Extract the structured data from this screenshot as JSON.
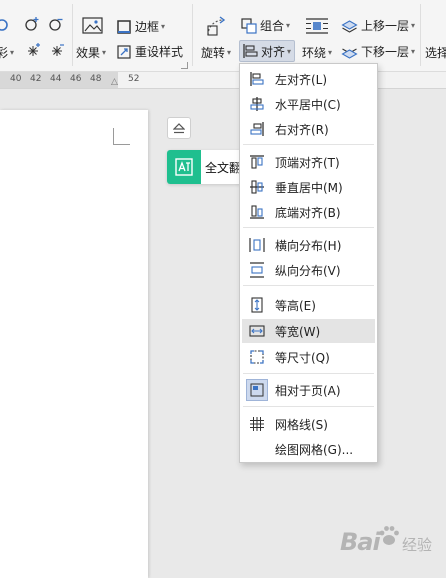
{
  "ribbon": {
    "color_fill_label": "彩",
    "effects_label": "效果",
    "border_label": "边框",
    "reset_style_label": "重设样式",
    "rotate_label": "旋转",
    "group_label": "组合",
    "align_label": "对齐",
    "wrap_label": "环绕",
    "bring_forward_label": "上移一层",
    "send_backward_label": "下移一层",
    "select_label": "选择"
  },
  "ruler": {
    "ticks": [
      "40",
      "42",
      "44",
      "46",
      "48",
      "52"
    ]
  },
  "sidebar": {
    "translate_label": "全文翻"
  },
  "align_menu": {
    "items": [
      {
        "label": "左对齐(L)",
        "icon": "align-left-icon"
      },
      {
        "label": "水平居中(C)",
        "icon": "align-center-icon"
      },
      {
        "label": "右对齐(R)",
        "icon": "align-right-icon"
      },
      {
        "label": "顶端对齐(T)",
        "icon": "align-top-icon"
      },
      {
        "label": "垂直居中(M)",
        "icon": "align-middle-icon"
      },
      {
        "label": "底端对齐(B)",
        "icon": "align-bottom-icon"
      },
      {
        "label": "横向分布(H)",
        "icon": "distribute-horizontal-icon"
      },
      {
        "label": "纵向分布(V)",
        "icon": "distribute-vertical-icon"
      },
      {
        "label": "等高(E)",
        "icon": "same-height-icon"
      },
      {
        "label": "等宽(W)",
        "icon": "same-width-icon"
      },
      {
        "label": "等尺寸(Q)",
        "icon": "same-size-icon"
      },
      {
        "label": "相对于页(A)",
        "icon": "relative-to-page-icon"
      },
      {
        "label": "网格线(S)",
        "icon": "gridlines-icon"
      },
      {
        "label": "绘图网格(G)...",
        "icon": ""
      }
    ],
    "highlighted": "等宽(W)",
    "checked": "相对于页(A)"
  },
  "watermark": {
    "text": "Bai",
    "text_cn": "经验"
  },
  "colors": {
    "accent_blue": "#3b73c4",
    "translate_green": "#1fbf8f",
    "highlight": "#e4e4e4"
  }
}
